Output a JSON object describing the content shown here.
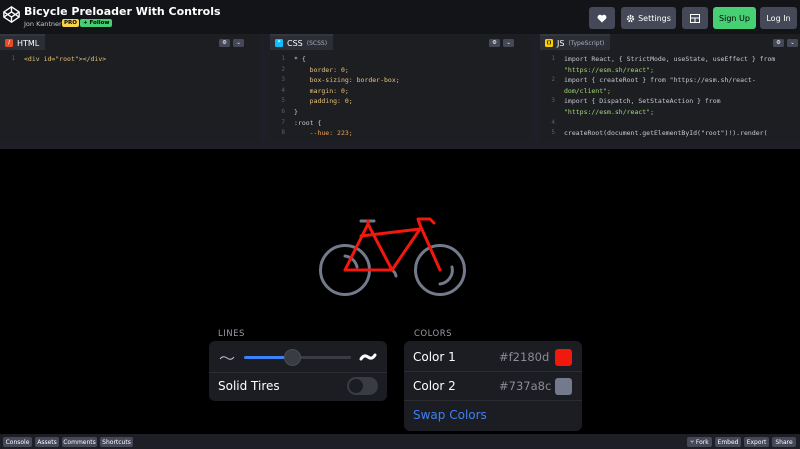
{
  "header": {
    "title": "Bicycle Preloader With Controls",
    "author": "Jon Kantner",
    "pro_badge": "PRO",
    "follow_label": "+ Follow",
    "heart_icon": "heart-icon",
    "settings_label": "Settings",
    "layout_icon": "layout-icon",
    "signup_label": "Sign Up",
    "login_label": "Log In"
  },
  "editors": {
    "html": {
      "tab_label": "HTML",
      "badge": "/",
      "lines": [
        {
          "n": "1",
          "text": "<div id=\"root\"></div>"
        }
      ]
    },
    "css": {
      "tab_label": "CSS",
      "tab_sub": "(SCSS)",
      "badge": "*",
      "lines": [
        {
          "n": "1",
          "text": "* {"
        },
        {
          "n": "2",
          "text": "    border: 0;"
        },
        {
          "n": "3",
          "text": "    box-sizing: border-box;"
        },
        {
          "n": "4",
          "text": "    margin: 0;"
        },
        {
          "n": "5",
          "text": "    padding: 0;"
        },
        {
          "n": "6",
          "text": "}"
        },
        {
          "n": "7",
          "text": ":root {"
        },
        {
          "n": "8",
          "text": "    --hue: 223;"
        }
      ]
    },
    "js": {
      "tab_label": "JS",
      "tab_sub": "(TypeScript)",
      "badge": "()",
      "lines": [
        {
          "n": "1",
          "text": "import React, { StrictMode, useState, useEffect } from"
        },
        {
          "n": "",
          "text": "\"https://esm.sh/react\";"
        },
        {
          "n": "2",
          "text": "import { createRoot } from \"https://esm.sh/react-"
        },
        {
          "n": "",
          "text": "dom/client\";"
        },
        {
          "n": "3",
          "text": "import { Dispatch, SetStateAction } from"
        },
        {
          "n": "",
          "text": "\"https://esm.sh/react\";"
        },
        {
          "n": "4",
          "text": ""
        },
        {
          "n": "5",
          "text": "createRoot(document.getElementById(\"root\")!).render("
        }
      ]
    }
  },
  "preview": {
    "lines_heading": "LINES",
    "lines_slider_value": 0.45,
    "solid_tires_label": "Solid Tires",
    "solid_tires_on": false,
    "colors_heading": "COLORS",
    "color1_label": "Color 1",
    "color1_hex": "#f2180d",
    "color2_label": "Color 2",
    "color2_hex": "#737a8c",
    "swap_label": "Swap Colors",
    "accent": "#3b82f6"
  },
  "footer": {
    "console": "Console",
    "assets": "Assets",
    "comments": "Comments",
    "shortcuts": "Shortcuts",
    "fork": "Fork",
    "embed": "Embed",
    "export": "Export",
    "share": "Share"
  }
}
